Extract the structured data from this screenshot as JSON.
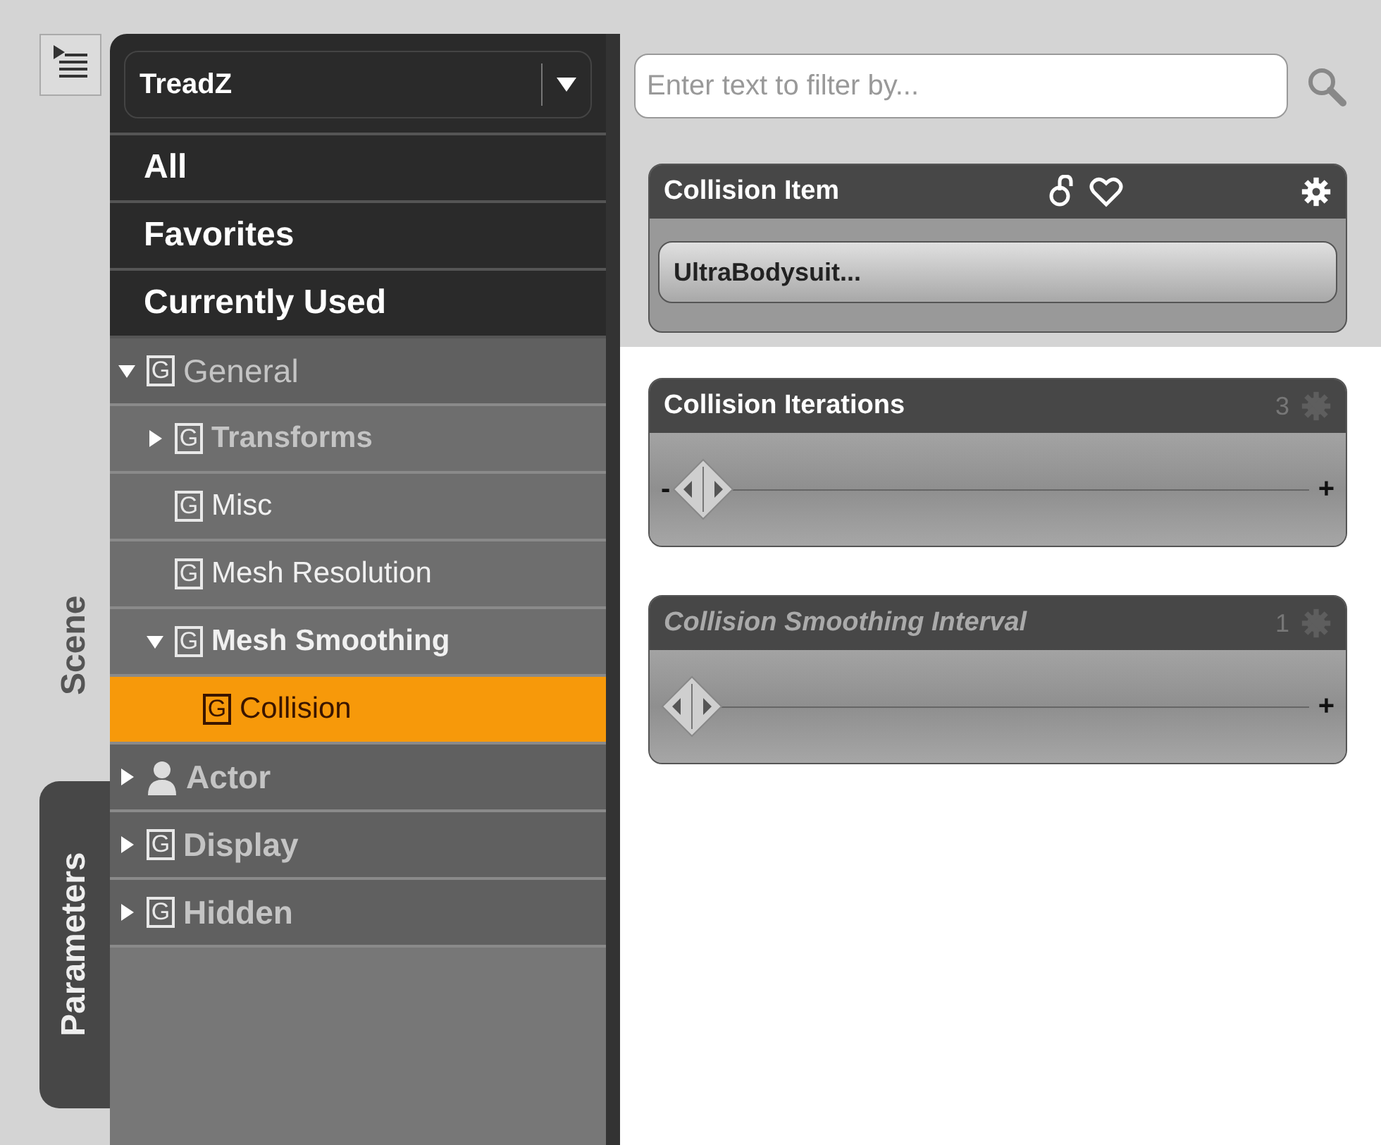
{
  "side_tabs": [
    {
      "label": "Scene",
      "selected": false
    },
    {
      "label": "Parameters",
      "selected": true
    }
  ],
  "node_selector": {
    "value": "TreadZ"
  },
  "filters": [
    {
      "label": "All"
    },
    {
      "label": "Favorites"
    },
    {
      "label": "Currently Used"
    }
  ],
  "tree": [
    {
      "label": "General",
      "kind": "group",
      "badge": "G",
      "dimmed": true,
      "active": false,
      "expanded": true,
      "selected": false,
      "children": [
        {
          "label": "Transforms",
          "kind": "group",
          "badge": "G",
          "dimmed": true,
          "active": false,
          "expanded": false,
          "selected": false
        },
        {
          "label": "Misc",
          "kind": "group",
          "badge": "G",
          "dimmed": false,
          "active": false,
          "selected": false
        },
        {
          "label": "Mesh Resolution",
          "kind": "group",
          "badge": "G",
          "dimmed": false,
          "active": false,
          "selected": false
        },
        {
          "label": "Mesh Smoothing",
          "kind": "group",
          "badge": "G",
          "dimmed": false,
          "active": true,
          "expanded": true,
          "selected": false,
          "children": [
            {
              "label": "Collision",
              "kind": "group",
              "badge": "G",
              "dimmed": false,
              "active": false,
              "selected": true
            }
          ]
        }
      ]
    },
    {
      "label": "Actor",
      "kind": "actor",
      "dimmed": true,
      "active": false,
      "expanded": false,
      "selected": false
    },
    {
      "label": "Display",
      "kind": "group",
      "badge": "G",
      "dimmed": true,
      "active": false,
      "expanded": false,
      "selected": false
    },
    {
      "label": "Hidden",
      "kind": "group",
      "badge": "G",
      "dimmed": true,
      "active": false,
      "expanded": false,
      "selected": false
    }
  ],
  "search": {
    "placeholder": "Enter text to filter by..."
  },
  "properties": [
    {
      "kind": "node",
      "title": "Collision Item",
      "value": "UltraBodysuit..."
    },
    {
      "kind": "slider",
      "title": "Collision Iterations",
      "reading": "3",
      "level": 0,
      "disabled": false,
      "minus": "-",
      "plus": "+"
    },
    {
      "kind": "slider",
      "title": "Collision Smoothing Interval",
      "reading": "1",
      "level": 0,
      "disabled": true,
      "plus": "+"
    }
  ]
}
